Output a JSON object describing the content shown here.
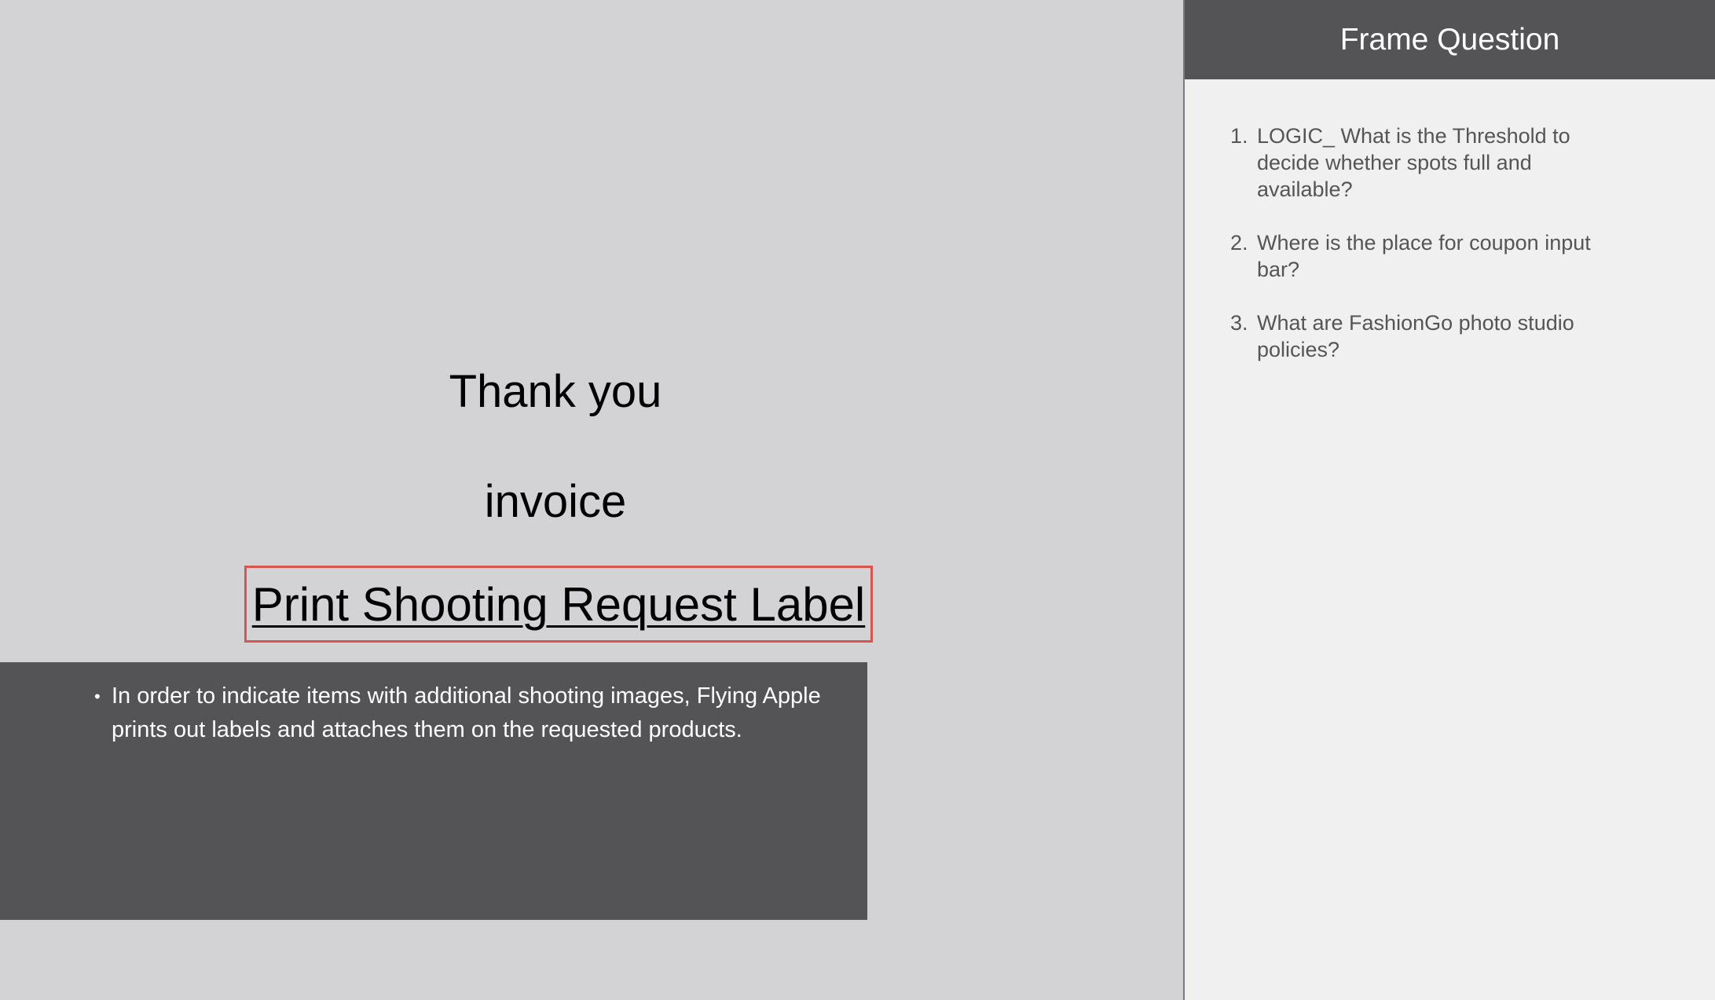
{
  "canvas": {
    "thank_you": "Thank you",
    "invoice": "invoice",
    "print_label_link": "Print Shooting Request Label",
    "note_bullets": [
      "In order to indicate items with additional shooting images, Flying Apple prints out labels and attaches them on the requested products."
    ]
  },
  "question_panel": {
    "title": "Frame Question",
    "questions": [
      "LOGIC_ What is the Threshold to decide whether spots full and available?",
      "Where is the place for coupon input bar?",
      "What are FashionGo photo studio policies?"
    ]
  },
  "colors": {
    "canvas_bg": "#d3d3d5",
    "dark_panel": "#545456",
    "highlight_border": "#d9534f",
    "side_bg": "#f0f0f0"
  }
}
